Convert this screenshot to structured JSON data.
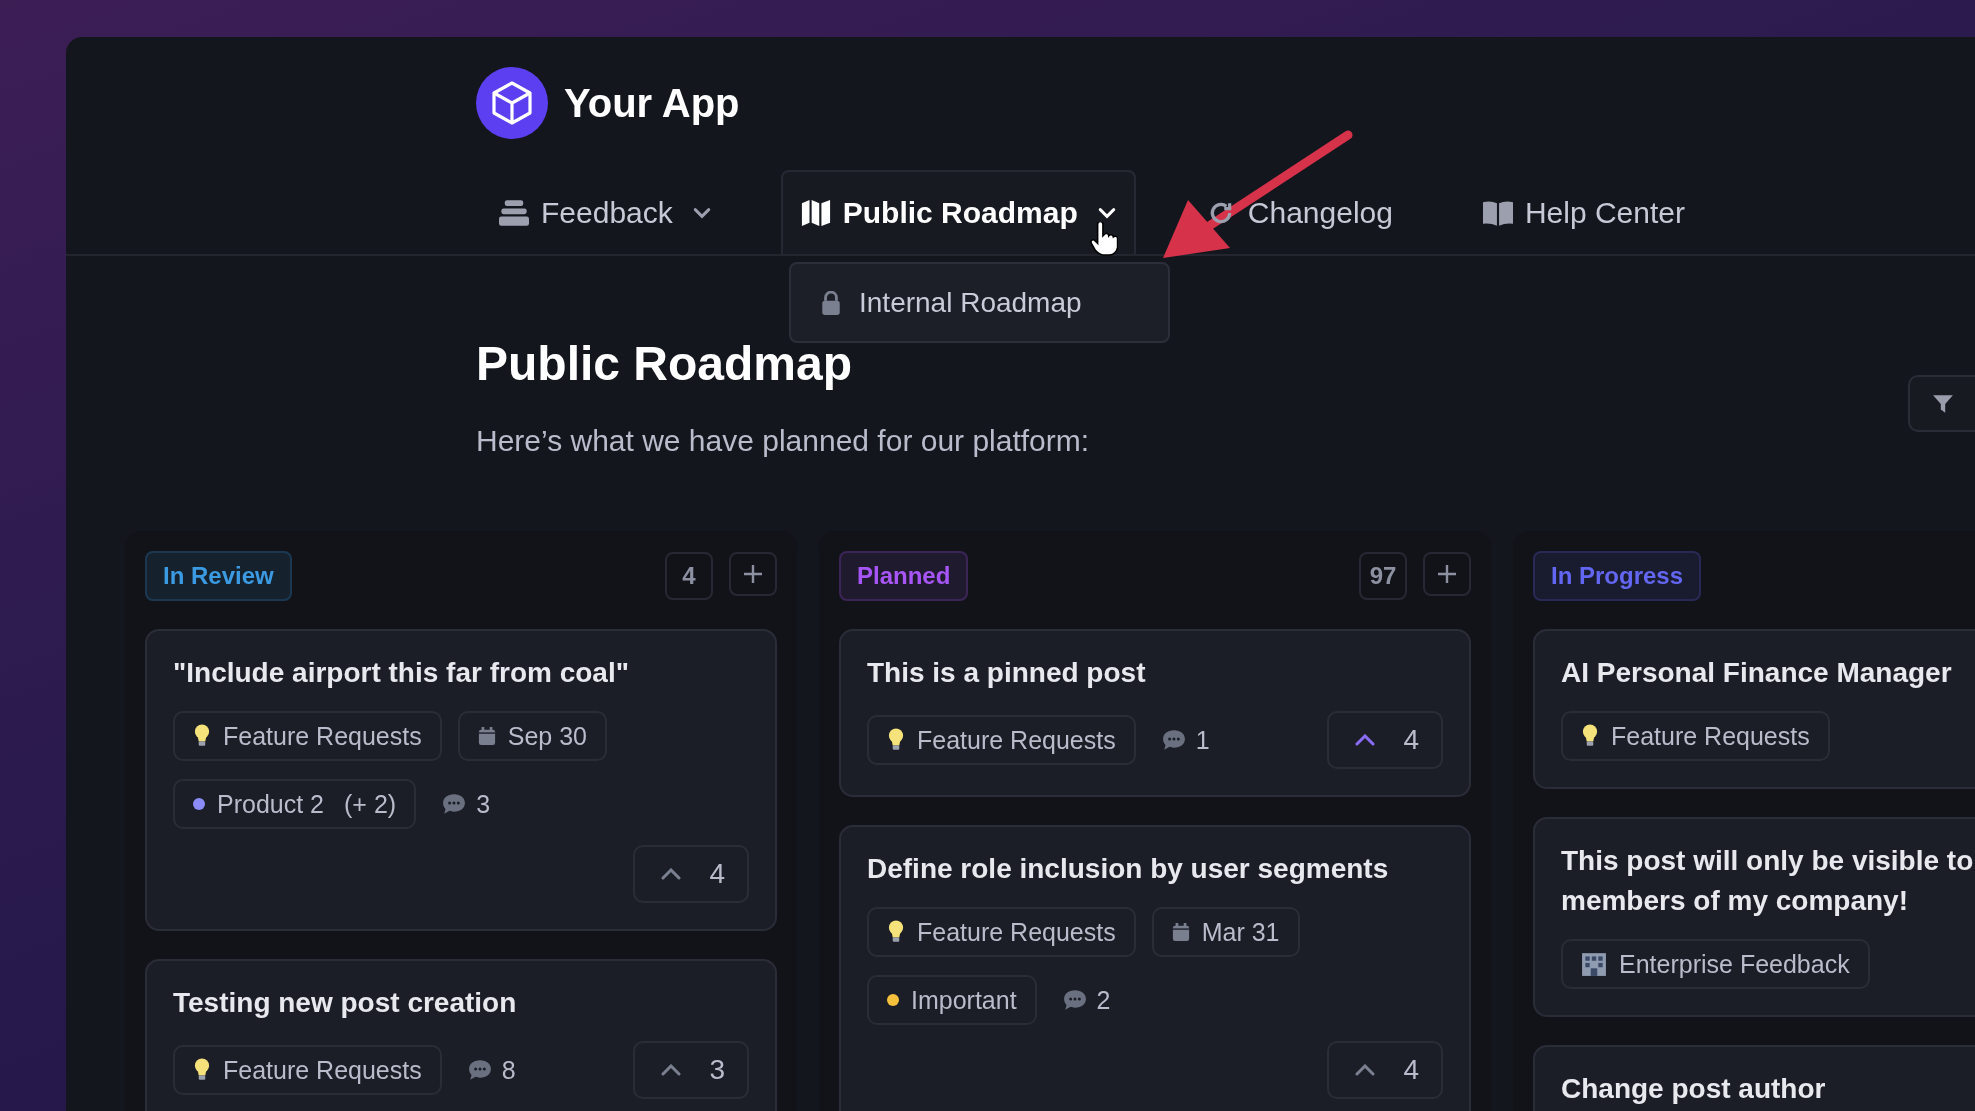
{
  "app": {
    "name": "Your App"
  },
  "nav": [
    {
      "label": "Feedback",
      "dropdown": true,
      "selected": false
    },
    {
      "label": "Public Roadmap",
      "dropdown": true,
      "selected": true
    },
    {
      "label": "Changelog",
      "dropdown": false,
      "selected": false
    },
    {
      "label": "Help Center",
      "dropdown": false,
      "selected": false
    }
  ],
  "dropdown_menu": [
    {
      "label": "Internal Roadmap"
    }
  ],
  "page": {
    "title": "Public Roadmap",
    "subtitle": "Here’s what we have planned for our platform:"
  },
  "columns": [
    {
      "status": "In Review",
      "color": "#3b9ae1",
      "count": "4",
      "can_add": true,
      "cards": [
        {
          "title": "\"Include airport this far from coal\"",
          "tags": [
            {
              "kind": "idea",
              "text": "Feature Requests"
            },
            {
              "kind": "date",
              "text": "Sep 30"
            },
            {
              "kind": "label",
              "text": "Product 2",
              "extra": "(+ 2)",
              "color": "#8b8cf8"
            },
            {
              "kind": "comments",
              "text": "3"
            }
          ],
          "votes": {
            "count": "4",
            "voted": false
          }
        },
        {
          "title": "Testing new post creation",
          "tags": [
            {
              "kind": "idea",
              "text": "Feature Requests"
            },
            {
              "kind": "comments",
              "text": "8"
            }
          ],
          "votes": {
            "count": "3",
            "voted": false
          }
        }
      ]
    },
    {
      "status": "Planned",
      "color": "#a855f7",
      "count": "97",
      "can_add": true,
      "cards": [
        {
          "title": "This is a pinned post",
          "tags": [
            {
              "kind": "idea",
              "text": "Feature Requests"
            },
            {
              "kind": "comments",
              "text": "1"
            }
          ],
          "votes": {
            "count": "4",
            "voted": true
          }
        },
        {
          "title": "Define role inclusion by user segments",
          "tags": [
            {
              "kind": "idea",
              "text": "Feature Requests"
            },
            {
              "kind": "date",
              "text": "Mar 31"
            },
            {
              "kind": "label",
              "text": "Important",
              "color": "#f5c03b"
            },
            {
              "kind": "comments",
              "text": "2"
            }
          ],
          "votes": {
            "count": "4",
            "voted": false
          }
        }
      ]
    },
    {
      "status": "In Progress",
      "color": "#6366f1",
      "can_add": false,
      "cards": [
        {
          "title": "AI Personal Finance Manager",
          "tags": [
            {
              "kind": "idea",
              "text": "Feature Requests"
            }
          ]
        },
        {
          "title": "This post will only be visible to members of my company!",
          "tags": [
            {
              "kind": "enterprise",
              "text": "Enterprise Feedback"
            }
          ]
        },
        {
          "title": "Change post author"
        }
      ]
    }
  ]
}
